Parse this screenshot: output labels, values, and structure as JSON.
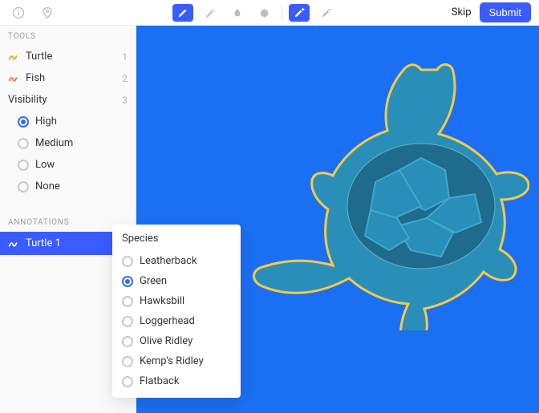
{
  "toolbar": {
    "skip_label": "Skip",
    "submit_label": "Submit"
  },
  "sidebar": {
    "tools_header": "TOOLS",
    "tools": [
      {
        "label": "Turtle",
        "count": "1",
        "color": "#f0a500"
      },
      {
        "label": "Fish",
        "count": "2",
        "color": "#ff6a2b"
      }
    ],
    "visibility_header": "Visibility",
    "visibility_count": "3",
    "visibility_options": [
      {
        "label": "High",
        "checked": true
      },
      {
        "label": "Medium",
        "checked": false
      },
      {
        "label": "Low",
        "checked": false
      },
      {
        "label": "None",
        "checked": false
      }
    ],
    "annotations_header": "ANNOTATIONS",
    "annotations": [
      {
        "label": "Turtle 1",
        "active": true
      }
    ]
  },
  "species": {
    "title": "Species",
    "options": [
      {
        "label": "Leatherback",
        "checked": false
      },
      {
        "label": "Green",
        "checked": true
      },
      {
        "label": "Hawksbill",
        "checked": false
      },
      {
        "label": "Loggerhead",
        "checked": false
      },
      {
        "label": "Olive Ridley",
        "checked": false
      },
      {
        "label": "Kemp's Ridley",
        "checked": false
      },
      {
        "label": "Flatback",
        "checked": false
      }
    ]
  }
}
